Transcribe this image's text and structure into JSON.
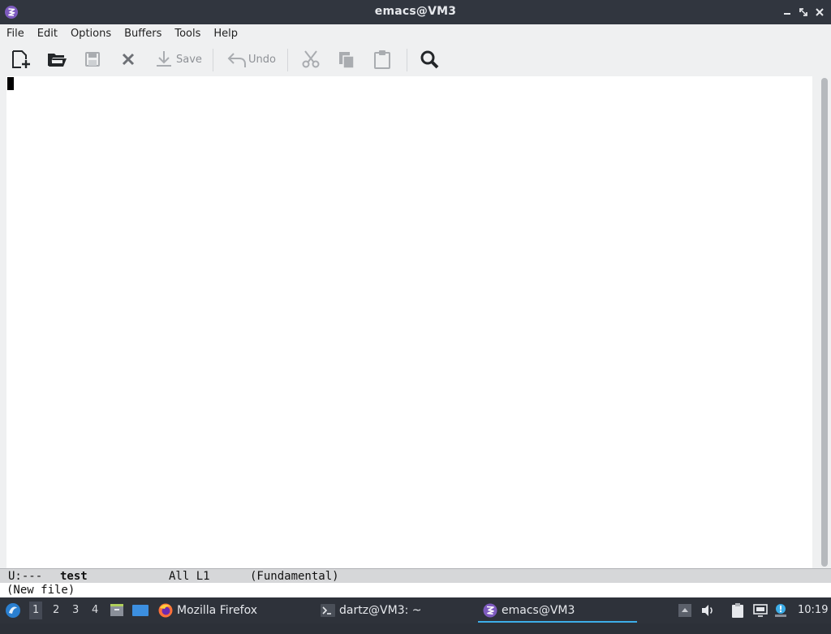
{
  "window": {
    "title": "emacs@VM3"
  },
  "menubar": {
    "items": [
      "File",
      "Edit",
      "Options",
      "Buffers",
      "Tools",
      "Help"
    ]
  },
  "toolbar": {
    "new_file_icon": "new-file-icon",
    "open_icon": "open-folder-icon",
    "save_label": "Save",
    "undo_label": "Undo"
  },
  "modeline": {
    "status": "U:---",
    "buffer": "test",
    "position": "All L1",
    "mode": "(Fundamental)"
  },
  "echo": {
    "message": "(New file)"
  },
  "taskbar": {
    "workspaces": [
      "1",
      "2",
      "3",
      "4"
    ],
    "tasks": {
      "firefox": "Mozilla Firefox",
      "terminal": "dartz@VM3: ~",
      "emacs": "emacs@VM3"
    },
    "clock": "10:19"
  },
  "colors": {
    "accent": "#3daee9",
    "titlebar": "#31363f",
    "taskbar": "#2e323a"
  }
}
